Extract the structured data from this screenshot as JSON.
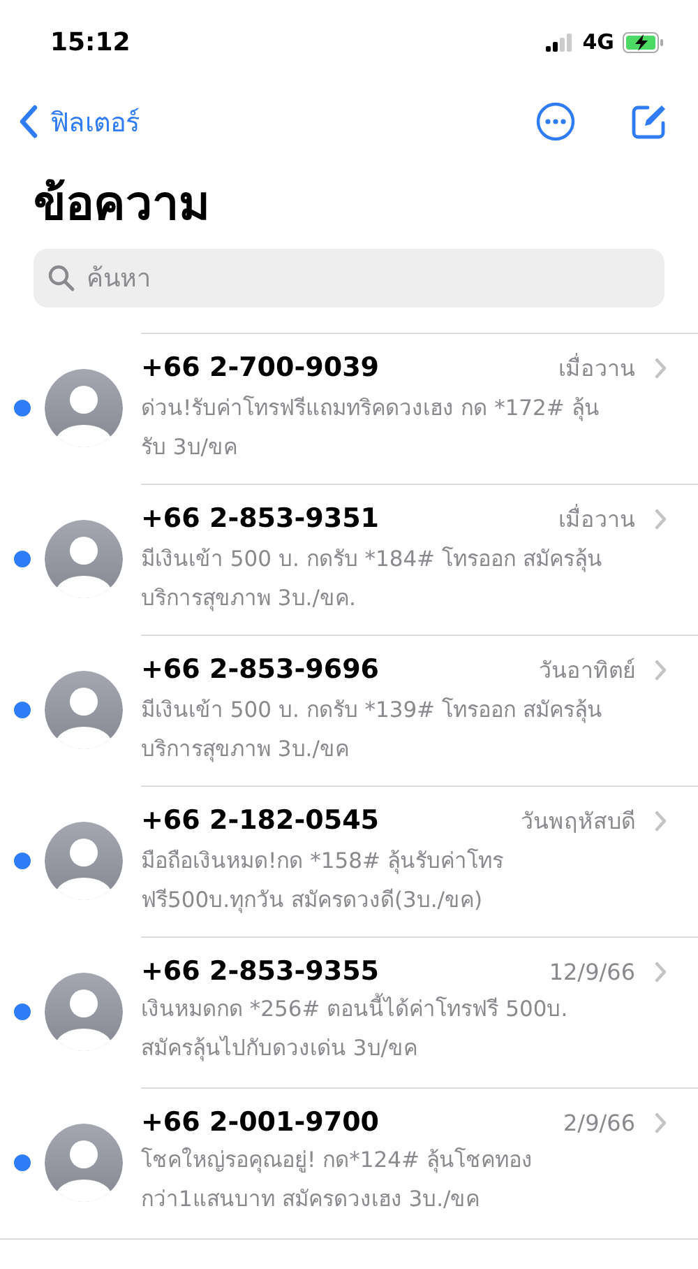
{
  "status_bar": {
    "time": "15:12",
    "network": "4G"
  },
  "nav": {
    "back_label": "ฟิลเตอร์"
  },
  "title": "ข้อความ",
  "search": {
    "placeholder": "ค้นหา"
  },
  "conversations": [
    {
      "sender": "+66 2-700-9039",
      "time": "เมื่อวาน",
      "preview": "ด่วน!รับค่าโทรฟรีแถมทริคดวงเฮง กด *172# ลุ้น\nรับ 3บ/ขค",
      "unread": true
    },
    {
      "sender": "+66 2-853-9351",
      "time": "เมื่อวาน",
      "preview": "มีเงินเข้า 500 บ. กดรับ *184# โทรออก สมัครลุ้น\nบริการสุขภาพ 3บ./ขค.",
      "unread": true
    },
    {
      "sender": "+66 2-853-9696",
      "time": "วันอาทิตย์",
      "preview": "มีเงินเข้า 500 บ. กดรับ *139# โทรออก สมัครลุ้น\nบริการสุขภาพ 3บ./ขค",
      "unread": true
    },
    {
      "sender": "+66 2-182-0545",
      "time": "วันพฤหัสบดี",
      "preview": "มือถือเงินหมด!กด *158# ลุ้นรับค่าโทร\nฟรี500บ.ทุกวัน สมัครดวงดี(3บ./ขค)",
      "unread": true
    },
    {
      "sender": "+66 2-853-9355",
      "time": "12/9/66",
      "preview": "เงินหมดกด *256# ตอนนี้ได้ค่าโทรฟรี 500บ.\nสมัครลุ้นไปกับดวงเด่น 3บ/ขค",
      "unread": true
    },
    {
      "sender": "+66 2-001-9700",
      "time": "2/9/66",
      "preview": "โชคใหญ่รอคุณอยู่! กด*124# ลุ้นโชคทอง\nกว่า1แสนบาท สมัครดวงเฮง 3บ./ขค",
      "unread": true
    }
  ]
}
